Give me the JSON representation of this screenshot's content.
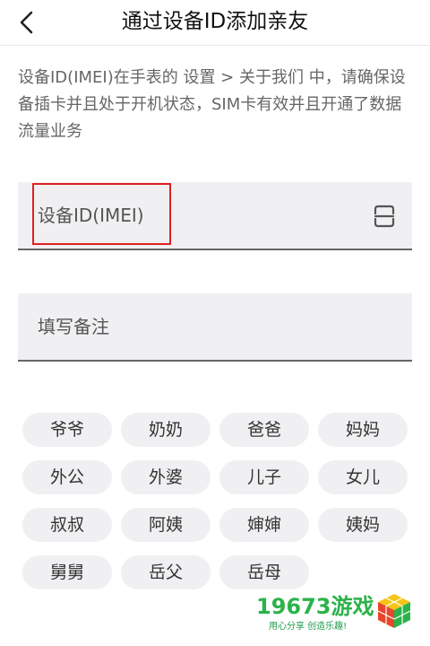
{
  "header": {
    "title": "通过设备ID添加亲友",
    "back_icon": "chevron-left-icon"
  },
  "description": "设备ID(IMEI)在手表的 设置 > 关于我们 中，请确保设备插卡并且处于开机状态，SIM卡有效并且开通了数据流量业务",
  "device_field": {
    "placeholder": "设备ID(IMEI)",
    "scan_icon": "scan-icon",
    "highlight_color": "#e02020"
  },
  "remark_field": {
    "placeholder": "填写备注"
  },
  "relations": [
    "爷爷",
    "奶奶",
    "爸爸",
    "妈妈",
    "外公",
    "外婆",
    "儿子",
    "女儿",
    "叔叔",
    "阿姨",
    "婶婶",
    "姨妈",
    "舅舅",
    "岳父",
    "岳母"
  ],
  "watermark": {
    "main": "19673游戏",
    "sub": "用心分享  创造乐趣!",
    "icon": "cube-logo-icon",
    "color": "#2bb34a"
  },
  "colors": {
    "field_bg": "#f0f0f2",
    "field_underline": "#666666",
    "text": "#333333",
    "description": "#666666"
  }
}
